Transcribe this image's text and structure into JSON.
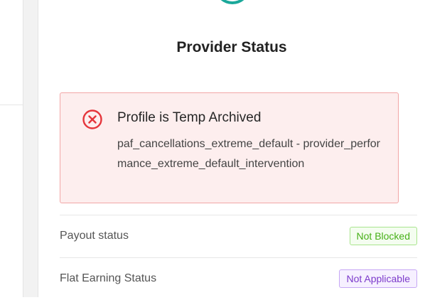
{
  "header": {
    "title": "Provider Status"
  },
  "alert": {
    "heading": "Profile is Temp Archived",
    "message": "paf_cancellations_extreme_default - provider_performance_extreme_default_intervention",
    "icon": "close-circle-icon",
    "color": "#e5353b"
  },
  "rows": [
    {
      "label": "Payout status",
      "badge": "Not Blocked",
      "badge_color": "#46b017"
    },
    {
      "label": "Flat Earning Status",
      "badge": "Not Applicable",
      "badge_color": "#7c3acb"
    }
  ]
}
